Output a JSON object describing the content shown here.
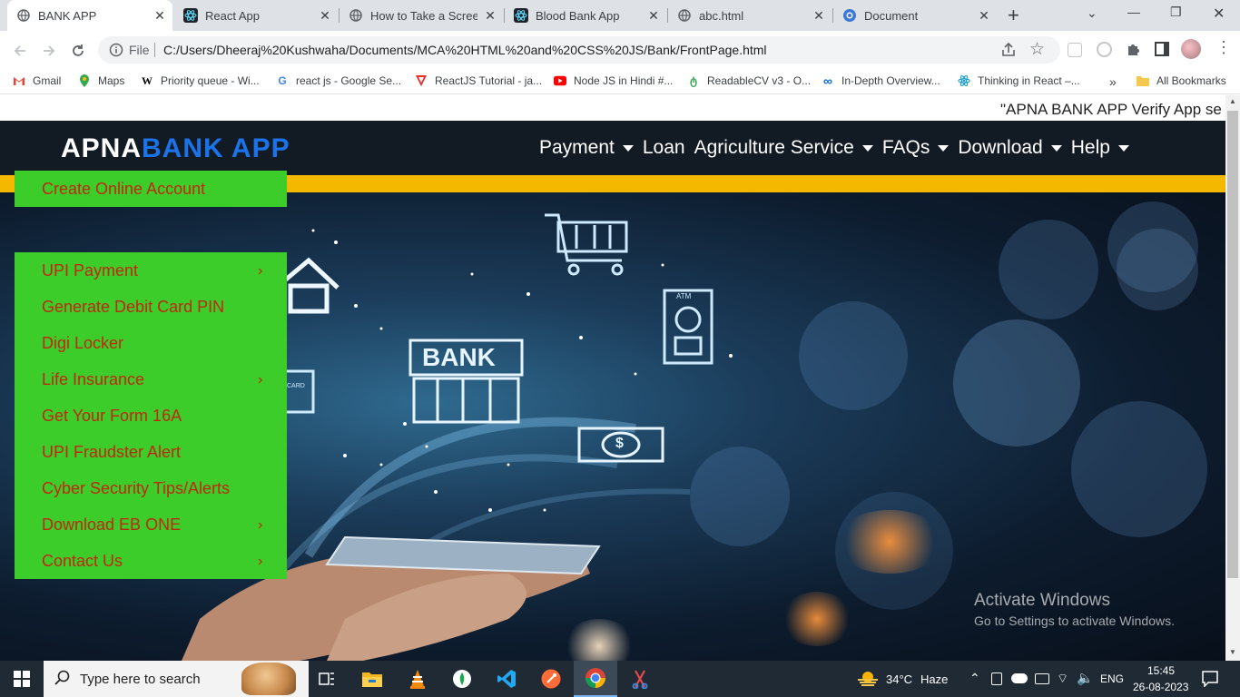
{
  "browser": {
    "tabs": [
      {
        "title": "BANK APP",
        "icon": "globe-icon",
        "active": true
      },
      {
        "title": "React App",
        "icon": "react-icon",
        "active": false
      },
      {
        "title": "How to Take a Screens",
        "icon": "globe-icon",
        "active": false
      },
      {
        "title": "Blood Bank App",
        "icon": "react-icon",
        "active": false
      },
      {
        "title": "abc.html",
        "icon": "globe-icon",
        "active": false
      },
      {
        "title": "Document",
        "icon": "document-icon",
        "active": false
      }
    ],
    "new_tab_label": "+",
    "window_controls": {
      "minimize": "—",
      "maximize": "❐",
      "close": "✕"
    },
    "address": {
      "scheme_label": "File",
      "url": "C:/Users/Dheeraj%20Kushwaha/Documents/MCA%20HTML%20and%20CSS%20JS/Bank/FrontPage.html"
    },
    "bookmarks": [
      {
        "label": "Gmail",
        "icon": "gmail-icon"
      },
      {
        "label": "Maps",
        "icon": "maps-icon"
      },
      {
        "label": "Priority queue - Wi...",
        "icon": "wikipedia-icon"
      },
      {
        "label": "react js - Google Se...",
        "icon": "google-icon"
      },
      {
        "label": "ReactJS Tutorial - ja...",
        "icon": "javatpoint-icon"
      },
      {
        "label": "Node JS in Hindi #...",
        "icon": "youtube-icon"
      },
      {
        "label": "ReadableCV v3 - O...",
        "icon": "readablecv-icon"
      },
      {
        "label": "In-Depth Overview...",
        "icon": "meta-icon"
      },
      {
        "label": "Thinking in React –...",
        "icon": "react-icon"
      }
    ],
    "bookmarks_overflow": "»",
    "all_bookmarks": "All Bookmarks"
  },
  "page": {
    "marquee": "\"APNA BANK APP Verify App se",
    "brand_part1": "APNA",
    "brand_part2": "BANK APP",
    "menu": [
      {
        "label": "Payment",
        "caret": true
      },
      {
        "label": "Loan",
        "caret": false
      },
      {
        "label": "Agriculture Service",
        "caret": true
      },
      {
        "label": "FAQs",
        "caret": true
      },
      {
        "label": "Download",
        "caret": true
      },
      {
        "label": "Help",
        "caret": true
      }
    ],
    "dropdown_top": "Create Online Account",
    "dropdown_items": [
      {
        "label": "UPI Payment",
        "chevron": "›"
      },
      {
        "label": "Generate Debit Card PIN",
        "chevron": ""
      },
      {
        "label": "Digi Locker",
        "chevron": ""
      },
      {
        "label": "Life Insurance",
        "chevron": "›"
      },
      {
        "label": "Get Your Form 16A",
        "chevron": ""
      },
      {
        "label": "UPI Fraudster Alert",
        "chevron": ""
      },
      {
        "label": "Cyber Security Tips/Alerts",
        "chevron": ""
      },
      {
        "label": "Download EB ONE",
        "chevron": "›"
      },
      {
        "label": "Contact Us",
        "chevron": "›"
      }
    ],
    "hero_sign": "BANK",
    "hero_atm": "ATM",
    "hero_money": "$",
    "hero_card": "CARD",
    "colors": {
      "header_bg": "#121a23",
      "brand_blue": "#1a73e8",
      "yellow_bar": "#f5b800",
      "dropdown_bg": "#3ccd2a",
      "dropdown_text": "#c0280e"
    }
  },
  "watermark": {
    "line1": "Activate Windows",
    "line2": "Go to Settings to activate Windows."
  },
  "taskbar": {
    "search_placeholder": "Type here to search",
    "apps": [
      "task-view-icon",
      "file-explorer-icon",
      "vlc-icon",
      "mongodb-icon",
      "vscode-icon",
      "postman-icon",
      "chrome-icon",
      "snipping-tool-icon"
    ],
    "weather_temp": "34°C",
    "weather_desc": "Haze",
    "language": "ENG",
    "time": "15:45",
    "date": "26-08-2023"
  }
}
